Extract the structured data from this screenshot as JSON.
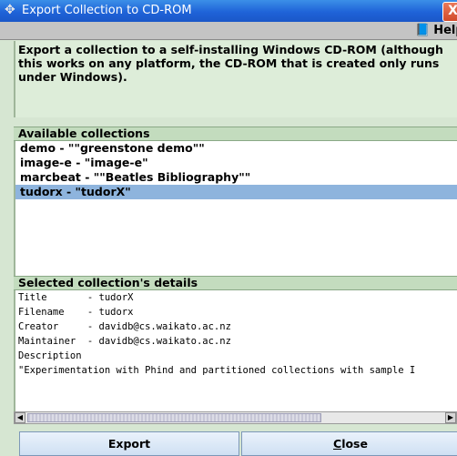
{
  "window": {
    "title": "Export Collection to CD-ROM",
    "close_symbol": "X"
  },
  "helpbar": {
    "help_label": "Help"
  },
  "description": "Export a collection to a self-installing Windows CD-ROM (although this works on any platform, the CD-ROM that is created only runs under Windows).",
  "available": {
    "heading": "Available collections",
    "items": [
      "demo - \"\"greenstone demo\"\"",
      "image-e - \"image-e\"",
      "marcbeat - \"\"Beatles Bibliography\"\"",
      "tudorx - \"tudorX\""
    ],
    "selected_index": 3
  },
  "details": {
    "heading": "Selected collection's details",
    "lines": [
      "Title       - tudorX",
      "Filename    - tudorx",
      "Creator     - davidb@cs.waikato.ac.nz",
      "Maintainer  - davidb@cs.waikato.ac.nz",
      "Description",
      "\"Experimentation with Phind and partitioned collections with sample I"
    ]
  },
  "buttons": {
    "export_label": "Export",
    "close_first": "C",
    "close_rest": "lose"
  },
  "colors": {
    "titlebar": "#1f63d8",
    "selection": "#8eb4dd",
    "panel": "#d6e6d2"
  }
}
